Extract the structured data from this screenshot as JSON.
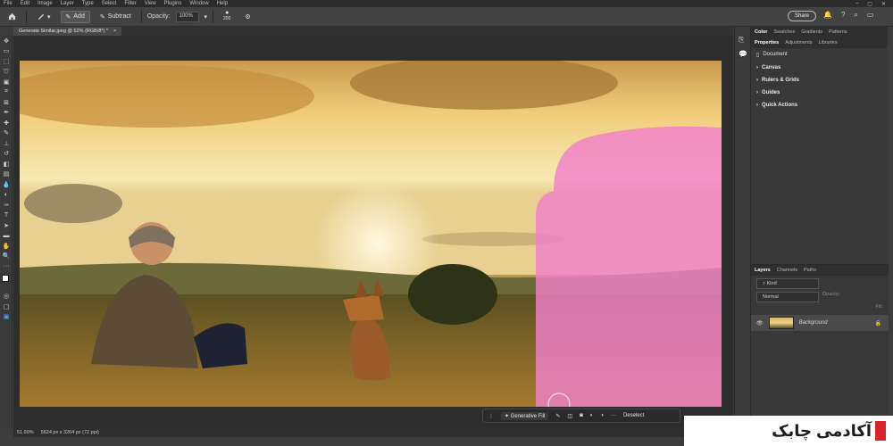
{
  "menubar": {
    "items": [
      "File",
      "Edit",
      "Image",
      "Layer",
      "Type",
      "Select",
      "Filter",
      "View",
      "Plugins",
      "Window",
      "Help"
    ],
    "window_controls": [
      "–",
      "▢",
      "✕"
    ]
  },
  "options_bar": {
    "home_icon": "home-icon",
    "add_label": "Add",
    "subtract_label": "Subtract",
    "opacity_label": "Opacity:",
    "opacity_value": "100%",
    "brush_size": "200",
    "share_label": "Share"
  },
  "document_tab": {
    "title": "Generate Similar.jpeg @ 52% (RGB/8*) *",
    "close": "×"
  },
  "status_bar": {
    "zoom": "51.99%",
    "dimensions": "5624 px x 3264 px (72 ppi)"
  },
  "generative_bar": {
    "label": "Generative Fill",
    "more": "···",
    "deselect": "Deselect"
  },
  "panels": {
    "top_tabs": [
      "Color",
      "Swatches",
      "Gradients",
      "Patterns"
    ],
    "prop_tabs": [
      "Properties",
      "Adjustments",
      "Libraries"
    ],
    "document_label": "Document",
    "sections": [
      "Canvas",
      "Rulers & Grids",
      "Guides",
      "Quick Actions"
    ],
    "layer_tabs": [
      "Layers",
      "Channels",
      "Paths"
    ],
    "kind_label": "Kind",
    "blend_mode": "Normal",
    "opacity_label": "Opacity:",
    "fill_label": "Fill:",
    "layer_name": "Background"
  },
  "watermark": {
    "text": "آکادمی چابک"
  },
  "colors": {
    "selection_overlay": "#f080c8",
    "panel_bg": "#383838",
    "menubar_bg": "#2b2b2b"
  }
}
